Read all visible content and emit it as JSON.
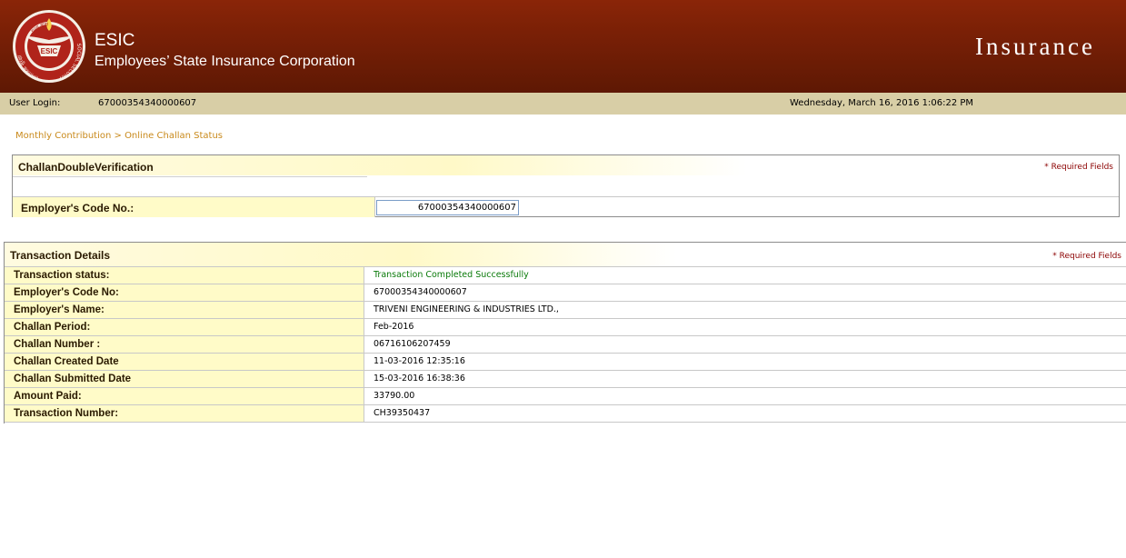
{
  "header": {
    "abbr": "ESIC",
    "org_name": "Employees’ State Insurance Corporation",
    "section": "Insurance",
    "logo_text": "ESIC",
    "logo_ring_left": "सामाजिक सुरक्षा",
    "logo_ring_right": "SOCIAL SECURITY",
    "logo_ring_top": "राज्य बीमा"
  },
  "login_bar": {
    "label": "User Login:",
    "user_id": "67000354340000607",
    "datetime": "Wednesday, March 16, 2016 1:06:22 PM"
  },
  "breadcrumb": {
    "items": [
      "Monthly Contribution",
      "Online Challan Status"
    ],
    "separator": " > "
  },
  "verification_panel": {
    "title": "ChallanDoubleVerification",
    "required_note": "* Required Fields",
    "field_label": "Employer's Code No.:",
    "field_value": "67000354340000607"
  },
  "transaction_panel": {
    "title": "Transaction Details",
    "required_note": "* Required Fields",
    "rows": [
      {
        "label": "Transaction status:",
        "value": "Transaction Completed Successfully"
      },
      {
        "label": "Employer's Code No:",
        "value": "67000354340000607"
      },
      {
        "label": "Employer's Name:",
        "value": "TRIVENI ENGINEERING & INDUSTRIES LTD.,"
      },
      {
        "label": "Challan Period:",
        "value": "Feb-2016"
      },
      {
        "label": "Challan Number :",
        "value": "06716106207459"
      },
      {
        "label": "Challan Created Date",
        "value": "11-03-2016 12:35:16"
      },
      {
        "label": "Challan Submitted Date",
        "value": "15-03-2016 16:38:36"
      },
      {
        "label": "Amount Paid:",
        "value": "33790.00"
      },
      {
        "label": "Transaction Number:",
        "value": "CH39350437"
      }
    ]
  },
  "colors": {
    "header_bg": "#7a2006",
    "login_bar_bg": "#d8cea6",
    "label_cell_bg": "#fffbc8",
    "breadcrumb": "#c98a1c",
    "success": "#0a7a0a",
    "required": "#8b0000"
  }
}
